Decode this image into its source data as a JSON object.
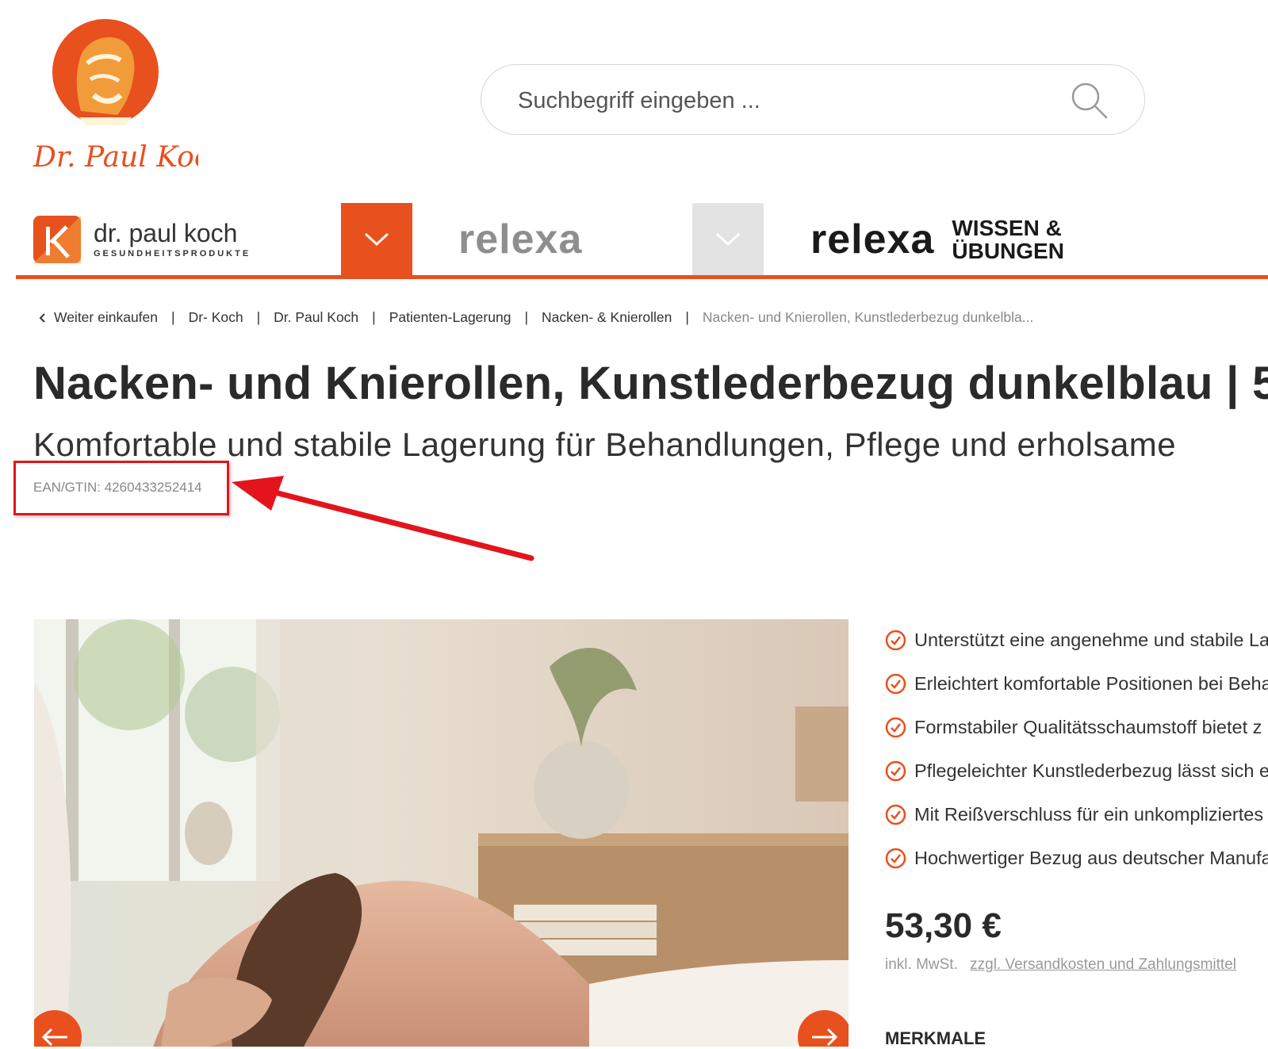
{
  "header": {
    "logo_text": "Dr. Paul Koch",
    "search": {
      "placeholder": "Suchbegriff eingeben ..."
    }
  },
  "brand_nav": {
    "brands": [
      {
        "name": "dr. paul koch",
        "tagline": "GESUNDHEITSPRODUKTE",
        "active": true
      },
      {
        "name": "relexa",
        "active": false
      },
      {
        "name": "relexa",
        "extra": "WISSEN & ÜBUNGEN"
      }
    ],
    "accent_color": "#e8501e"
  },
  "breadcrumb": {
    "back_label": "Weiter einkaufen",
    "items": [
      "Dr- Koch",
      "Dr. Paul Koch",
      "Patienten-Lagerung",
      "Nacken- & Knierollen"
    ],
    "current": "Nacken- und Knierollen, Kunstlederbezug dunkelbla..."
  },
  "product": {
    "title": "Nacken- und Knierollen, Kunstlederbezug dunkelblau | 5",
    "subtitle": "Komfortable und stabile Lagerung für Behandlungen, Pflege und erholsame",
    "ean": "EAN/GTIN: 4260433252414",
    "features": [
      "Unterstützt eine angenehme und stabile La",
      "Erleichtert komfortable Positionen bei Beha",
      "Formstabiler Qualitätsschaumstoff bietet z",
      "Pflegeleichter Kunstlederbezug lässt sich e",
      "Mit Reißverschluss für ein unkompliziertes",
      "Hochwertiger Bezug aus deutscher Manufa"
    ],
    "price": "53,30 €",
    "vat_label": "inkl. MwSt.",
    "shipping_link": "zzgl. Versandkosten und Zahlungsmittel",
    "features_heading": "MERKMALE"
  }
}
